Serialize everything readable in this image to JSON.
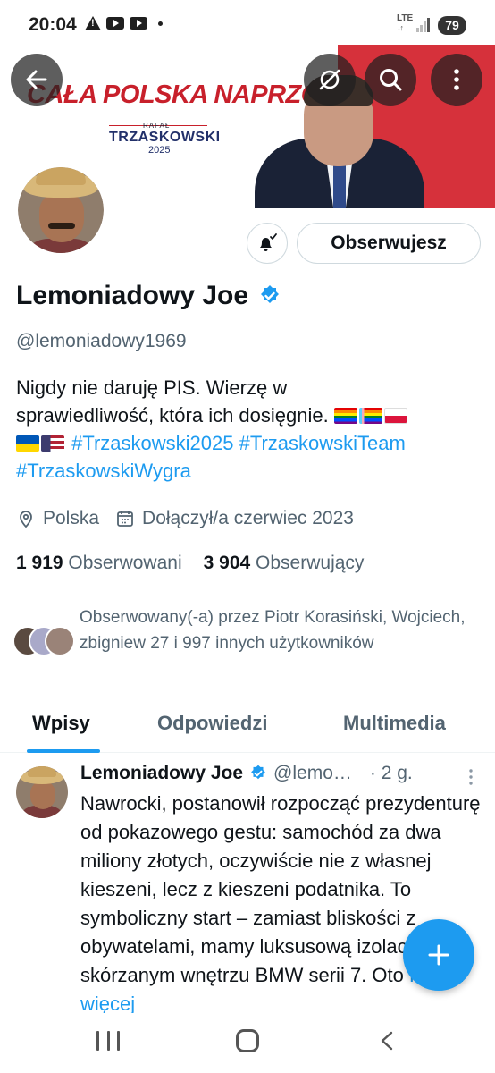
{
  "status_bar": {
    "time": "20:04",
    "network": "LTE",
    "battery": "79",
    "icons": [
      "warning-icon",
      "youtube-icon",
      "youtube-icon",
      "dot-icon",
      "signal-icon",
      "battery-icon"
    ]
  },
  "banner": {
    "slogan": "CAŁA POLSKA NAPRZÓD!",
    "name_small": "RAFAŁ",
    "name": "TRZASKOWSKI",
    "year": "2025",
    "colors": {
      "red": "#d6313b",
      "navy": "#22306a"
    }
  },
  "header_actions": [
    "back-arrow-icon",
    "grok-icon",
    "search-icon",
    "more-vertical-icon"
  ],
  "profile": {
    "follow_button": "Obserwujesz",
    "name": "Lemoniadowy Joe",
    "handle": "@lemoniadowy1969",
    "bio_line1": "Nigdy nie daruję PIS. Wierzę w",
    "bio_line2": "sprawiedliwość, która ich dosięgnie.",
    "hashtags": [
      "#Trzaskowski2025",
      "#TrzaskowskiTeam",
      "#TrzaskowskiWygra"
    ],
    "location": "Polska",
    "joined": "Dołączył/a czerwiec 2023",
    "following_count": "1 919",
    "following_label": "Obserwowani",
    "followers_count": "3 904",
    "followers_label": "Obserwujący",
    "followed_by": "Obserwowany(-a) przez Piotr Korasiński, Wojciech, zbigniew 27 i 997 innych użytkowników"
  },
  "tabs": [
    {
      "label": "Wpisy",
      "active": true
    },
    {
      "label": "Odpowiedzi",
      "active": false
    },
    {
      "label": "Multimedia",
      "active": false
    }
  ],
  "tweet": {
    "name": "Lemoniadowy Joe",
    "handle": "@lemo…",
    "time": "· 2 g.",
    "text": "Nawrocki, postanowił rozpocząć prezydenturę od pokazowego gestu: samochód za dwa miliony złotych, oczywiście nie z własnej kieszeni, lecz z kieszeni podatnika. To symboliczny start – zamiast bliskości z obywatelami, mamy luksusową izolację w skórzanym wnętrzu BMW serii 7. Oto",
    "show_more": "Pokaż więcej"
  },
  "fab": "plus-icon",
  "nav_bar": [
    "recents-icon",
    "home-icon",
    "back-icon"
  ],
  "accent_color": "#1d9bf0"
}
